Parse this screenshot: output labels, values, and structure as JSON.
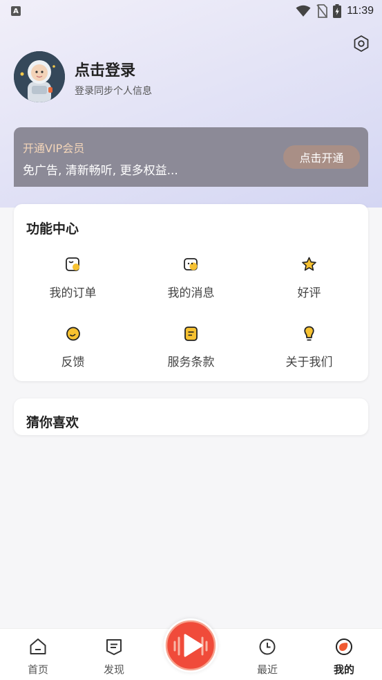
{
  "status_bar": {
    "time": "11:39",
    "app_icon": "A"
  },
  "profile": {
    "title": "点击登录",
    "subtitle": "登录同步个人信息"
  },
  "vip": {
    "title": "开通VIP会员",
    "desc": "免广告, 清新畅听, 更多权益...",
    "button": "点击开通"
  },
  "function_center": {
    "title": "功能中心",
    "items": [
      {
        "label": "我的订单",
        "icon": "order-icon"
      },
      {
        "label": "我的消息",
        "icon": "message-icon"
      },
      {
        "label": "好评",
        "icon": "star-icon"
      },
      {
        "label": "反馈",
        "icon": "feedback-icon"
      },
      {
        "label": "服务条款",
        "icon": "terms-icon"
      },
      {
        "label": "关于我们",
        "icon": "bulb-icon"
      }
    ]
  },
  "guess": {
    "title": "猜你喜欢"
  },
  "colors": {
    "accent": "#f7c231",
    "play": "#f04b3a",
    "vip_bg": "#8c8a97",
    "vip_gold": "#f3d5b9"
  },
  "bottom_nav": [
    {
      "label": "首页",
      "icon": "home-icon"
    },
    {
      "label": "发现",
      "icon": "discover-icon"
    },
    {
      "label": "最近",
      "icon": "clock-icon"
    },
    {
      "label": "我的",
      "icon": "me-icon",
      "active": true
    }
  ]
}
